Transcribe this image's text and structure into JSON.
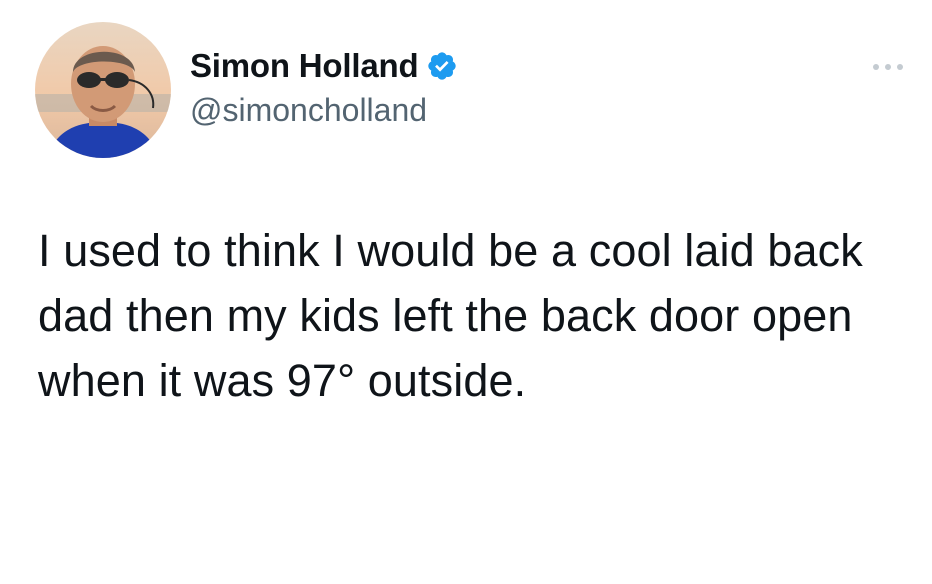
{
  "author": {
    "display_name": "Simon Holland",
    "handle": "@simoncholland",
    "verified_icon": "verified-badge-icon",
    "avatar_icon": "profile-photo"
  },
  "menu": {
    "icon": "more-options-icon"
  },
  "tweet": {
    "text": "I used to think I would be a cool laid back dad then my kids left the back door open when it was 97° outside."
  },
  "colors": {
    "text": "#0f1419",
    "secondary_text": "#536471",
    "verified": "#1d9bf0",
    "background": "#ffffff"
  }
}
